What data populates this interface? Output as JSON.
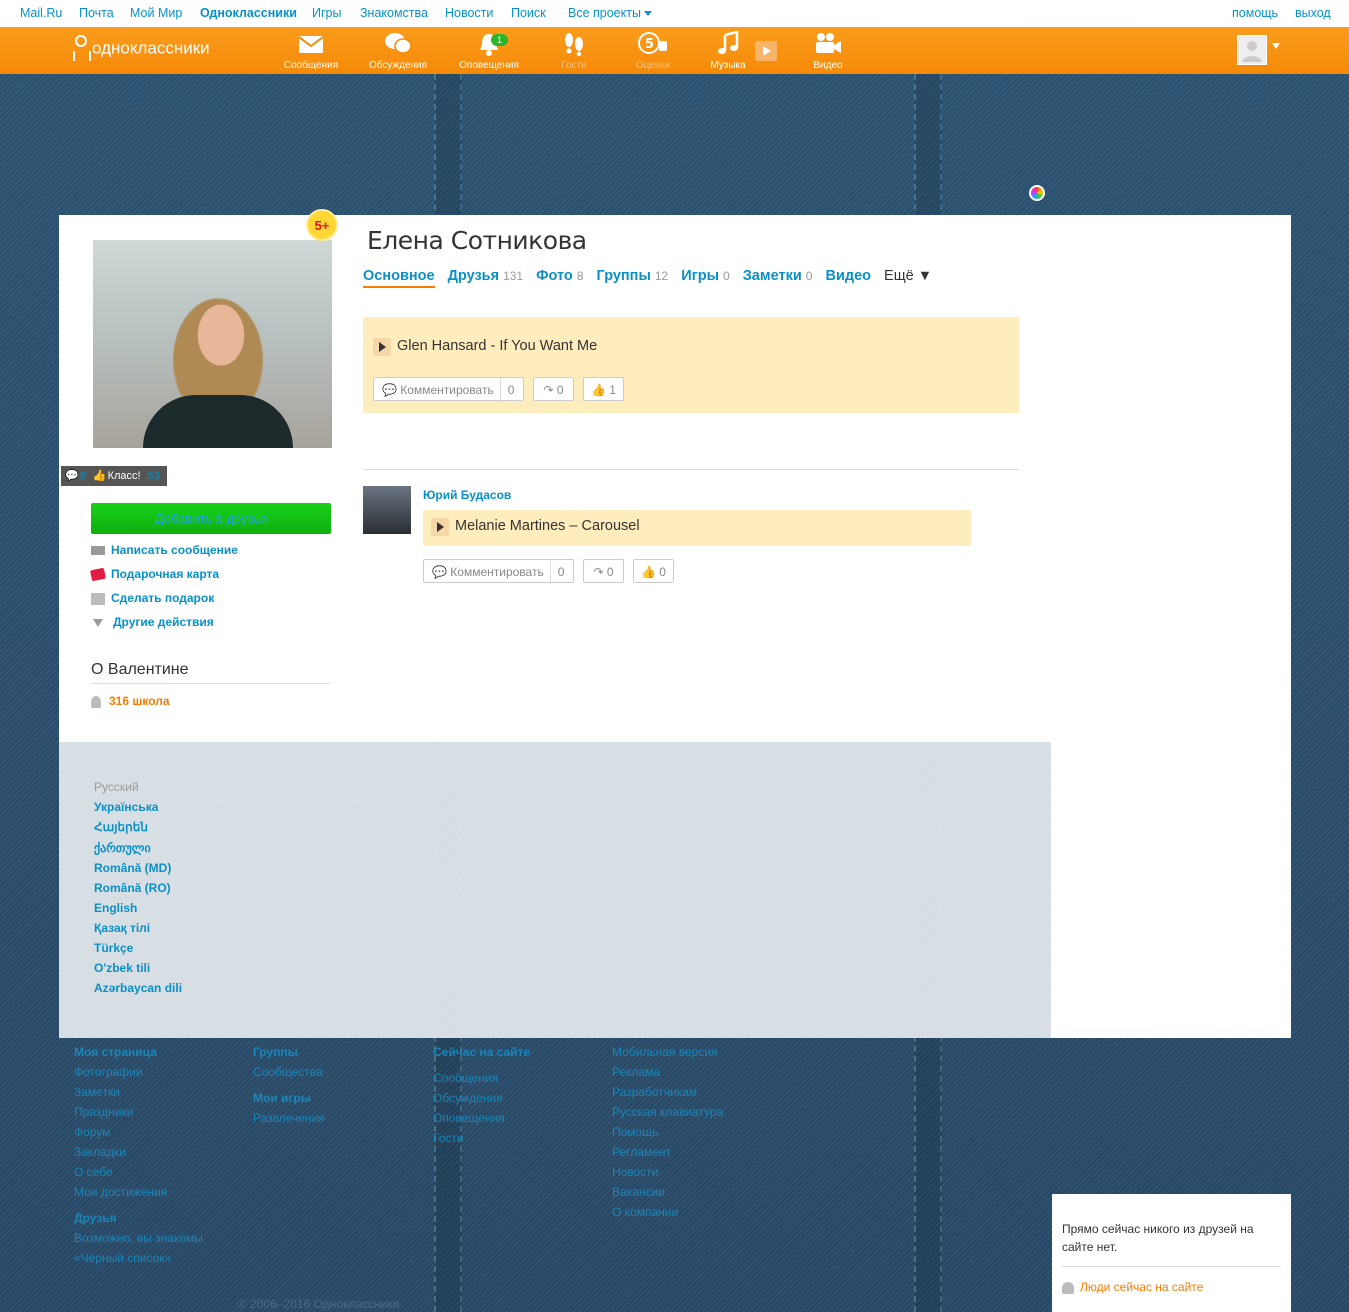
{
  "topbar": {
    "links": [
      "Mail.Ru",
      "Почта",
      "Мой Мир",
      "Одноклассники",
      "Игры",
      "Знакомства",
      "Новости",
      "Поиск"
    ],
    "all_projects": "Все проекты",
    "help": "помощь",
    "logout": "выход"
  },
  "nav": {
    "logo": "одноклассники",
    "items": [
      {
        "label": "Сообщения",
        "icon": "envelope-icon"
      },
      {
        "label": "Обсуждения",
        "icon": "chat-bubbles-icon"
      },
      {
        "label": "Оповещения",
        "icon": "bell-icon",
        "badge": "1"
      },
      {
        "label": "Гости",
        "icon": "footprints-icon"
      },
      {
        "label": "Оценки",
        "icon": "rating-five-icon"
      },
      {
        "label": "Музыка",
        "icon": "music-note-icon"
      },
      {
        "label": "Видео",
        "icon": "video-camera-icon"
      }
    ]
  },
  "profile": {
    "name": "Елена Сотникова",
    "badge": "5+",
    "stats": {
      "comments": "8",
      "klass_label": "Класс!",
      "klass": "53"
    },
    "add_friend": "Добавить в друзья",
    "actions": [
      "Написать сообщение",
      "Подарочная карта",
      "Сделать подарок",
      "Другие действия"
    ],
    "about_title": "О Валентине",
    "school": "316 школа"
  },
  "tabs": [
    {
      "label": "Основное",
      "count": ""
    },
    {
      "label": "Друзья",
      "count": "131"
    },
    {
      "label": "Фото",
      "count": "8"
    },
    {
      "label": "Группы",
      "count": "12"
    },
    {
      "label": "Игры",
      "count": "0"
    },
    {
      "label": "Заметки",
      "count": "0"
    },
    {
      "label": "Видео",
      "count": ""
    }
  ],
  "tab_more": "Ещё ▼",
  "feed": {
    "post1": {
      "song": "Glen Hansard - If You Want Me",
      "comment_label": "Комментировать",
      "comments": "0",
      "shares": "0",
      "likes": "1"
    },
    "post2": {
      "author": "Юрий Будасов",
      "song": "Melanie Martines – Carousel",
      "comment_label": "Комментировать",
      "comments": "0",
      "shares": "0",
      "likes": "0"
    }
  },
  "languages": [
    "Русский",
    "Українська",
    "Հայերեն",
    "ქართული",
    "Română (MD)",
    "Română (RO)",
    "English",
    "Қазақ тілі",
    "Türkçe",
    "O'zbek tili",
    "Azərbaycan dili"
  ],
  "footer": {
    "col1": [
      "Моя страница",
      "Фотографии",
      "Заметки",
      "Праздники",
      "Форум",
      "Закладки",
      "О себе",
      "Мои достижения",
      "Друзья",
      "Возможно, вы знакомы",
      "«Чёрный список»"
    ],
    "col2": [
      "Группы",
      "Сообщества",
      "Мои игры",
      "Развлечения"
    ],
    "col3": [
      "Сейчас на сайте",
      "Сообщения",
      "Обсуждения",
      "Оповещения",
      "Гости"
    ],
    "col4": [
      "Мобильная версия",
      "Реклама",
      "Разработчикам",
      "Русская клавиатура",
      "Помощь",
      "Регламент",
      "Новости",
      "Вакансии",
      "О компании"
    ],
    "copyright": "© 2006–2016 Одноклассники"
  },
  "online": {
    "text": "Прямо сейчас никого из друзей на сайте нет.",
    "people_link": "Люди сейчас на сайте"
  }
}
